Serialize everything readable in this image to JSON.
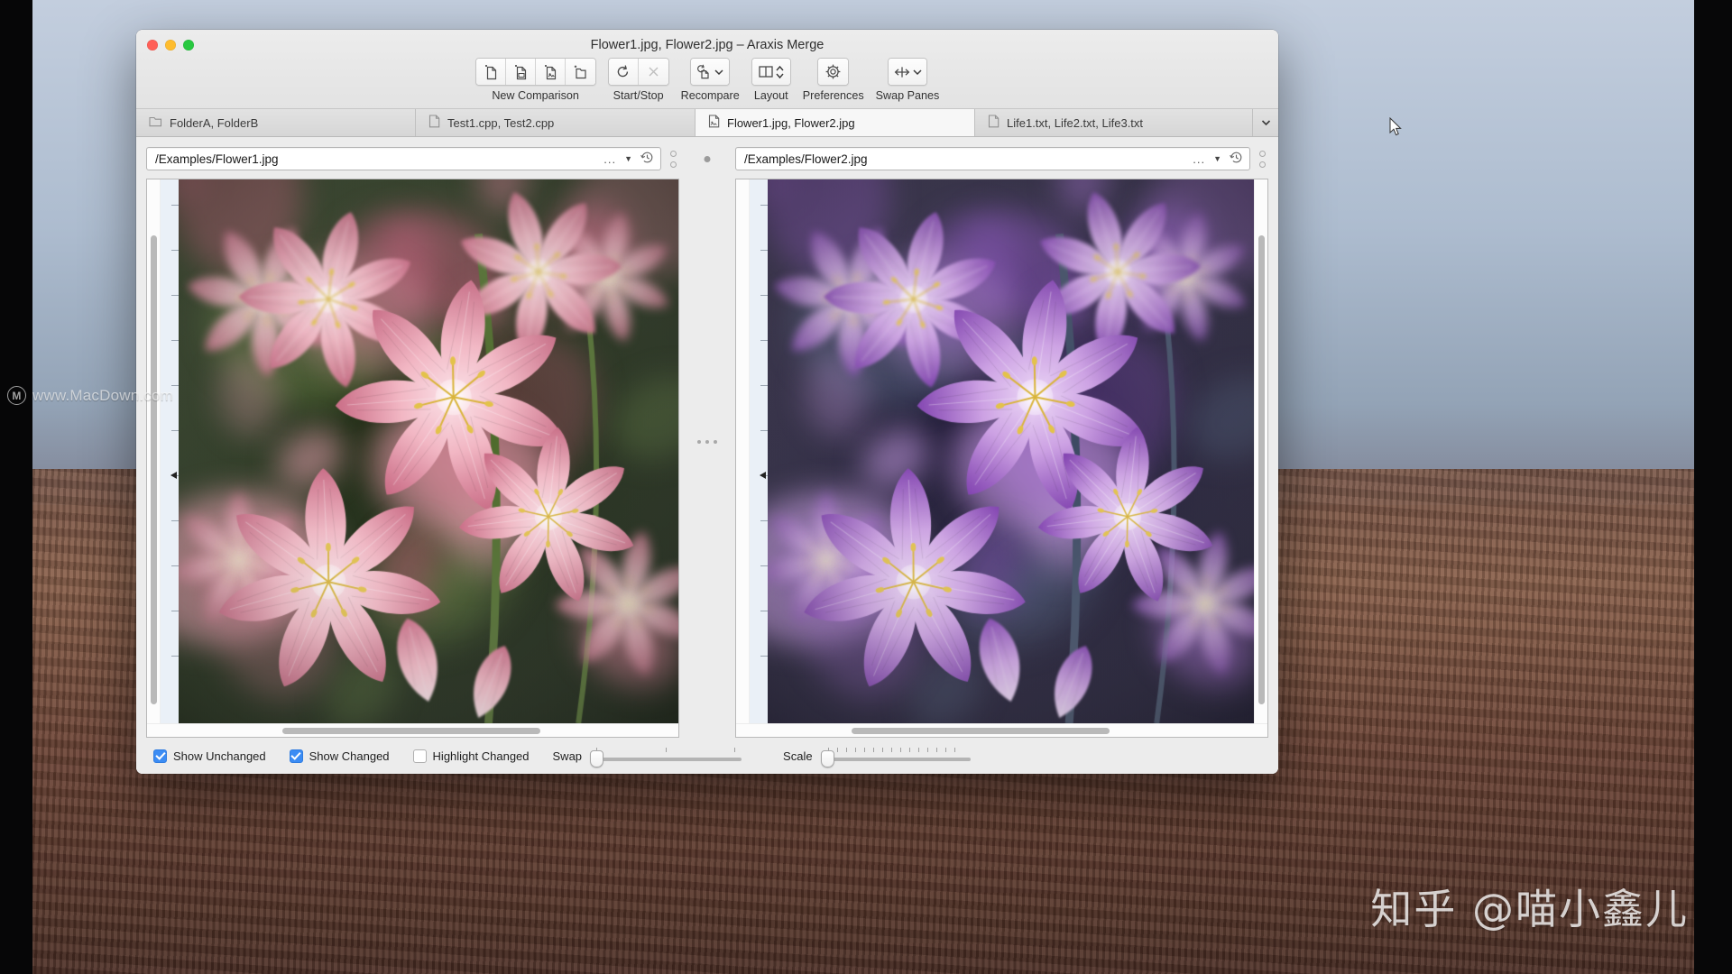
{
  "window": {
    "title": "Flower1.jpg, Flower2.jpg – Araxis Merge",
    "traffic_lights": [
      "close",
      "minimize",
      "zoom"
    ]
  },
  "toolbar": {
    "groups": [
      {
        "label": "New Comparison",
        "name": "new-comparison",
        "buttons": [
          {
            "name": "new-text-comparison-button",
            "icon": "new-file-icon"
          },
          {
            "name": "new-binary-comparison-button",
            "icon": "new-binary-file-icon"
          },
          {
            "name": "new-image-comparison-button",
            "icon": "new-image-file-icon"
          },
          {
            "name": "new-folder-comparison-button",
            "icon": "new-folder-icon"
          }
        ]
      },
      {
        "label": "Start/Stop",
        "name": "start-stop",
        "buttons": [
          {
            "name": "start-button",
            "icon": "refresh-icon"
          },
          {
            "name": "stop-button",
            "icon": "close-x-icon",
            "disabled": true
          }
        ]
      },
      {
        "label": "Recompare",
        "name": "recompare",
        "buttons": [
          {
            "name": "recompare-button",
            "icon": "recompare-icon",
            "caret": true
          }
        ]
      },
      {
        "label": "Layout",
        "name": "layout",
        "buttons": [
          {
            "name": "layout-button",
            "icon": "two-pane-icon",
            "stepper": true
          }
        ]
      },
      {
        "label": "Preferences",
        "name": "preferences",
        "buttons": [
          {
            "name": "preferences-button",
            "icon": "gear-icon"
          }
        ]
      },
      {
        "label": "Swap Panes",
        "name": "swap-panes",
        "buttons": [
          {
            "name": "swap-panes-button",
            "icon": "swap-arrows-icon",
            "caret": true
          }
        ]
      }
    ]
  },
  "tabs": [
    {
      "label": "FolderA, FolderB",
      "icon": "folder-icon",
      "active": false
    },
    {
      "label": "Test1.cpp, Test2.cpp",
      "icon": "file-icon",
      "active": false
    },
    {
      "label": "Flower1.jpg, Flower2.jpg",
      "icon": "image-file-icon",
      "active": true
    },
    {
      "label": "Life1.txt, Life2.txt, Life3.txt",
      "icon": "file-icon",
      "active": false
    }
  ],
  "tab_overflow_icon": "chevron-down-icon",
  "panes": {
    "left": {
      "path": "/Examples/Flower1.jpg",
      "ellipsis": "...",
      "caret_icon": "caret-down-icon",
      "history_icon": "history-clock-icon"
    },
    "right": {
      "path": "/Examples/Flower2.jpg",
      "ellipsis": "...",
      "caret_icon": "caret-down-icon",
      "history_icon": "history-clock-icon"
    }
  },
  "statusbar": {
    "checkboxes": [
      {
        "label": "Show Unchanged",
        "checked": true,
        "name": "show-unchanged-checkbox"
      },
      {
        "label": "Show Changed",
        "checked": true,
        "name": "show-changed-checkbox"
      },
      {
        "label": "Highlight Changed",
        "checked": false,
        "name": "highlight-changed-checkbox"
      }
    ],
    "swap": {
      "label": "Swap",
      "value": 0,
      "ticks": 3
    },
    "scale": {
      "label": "Scale",
      "value": 0,
      "ticks": 15
    }
  },
  "watermarks": {
    "macdown": "www.MacDown.com",
    "macdown_logo": "M",
    "zhihu": "知乎 @喵小鑫儿"
  },
  "colors": {
    "accent": "#3b8cf4",
    "window_chrome": "#ececec",
    "active_tab": "#f7f7f7",
    "left_flower": "#d9657f",
    "right_flower": "#9b58c4"
  }
}
